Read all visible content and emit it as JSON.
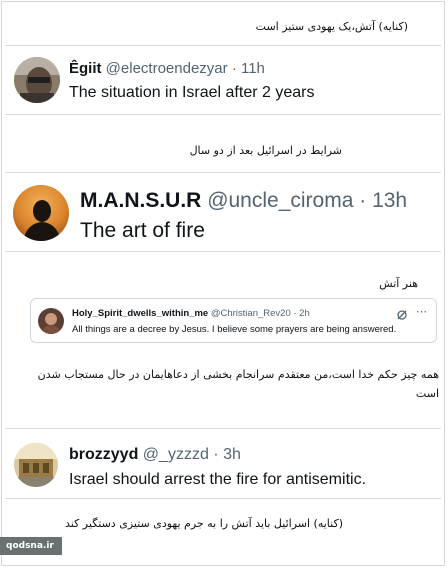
{
  "captions": {
    "c1": "(کنایه) آتش،یک یهودی ستیز است",
    "c2": "شرایط در اسرائیل بعد از دو سال",
    "c3": "هنر آتش",
    "c4_line1": "همه چیز حکم خدا است،من معتقدم سرانجام بخشی از دعاهایمان در حال مستجاب شدن",
    "c4_line2": "است",
    "c5": "(کنایه) اسرائیل باید آتش را به جرم یهودی ستیزی دستگیر کند"
  },
  "tweet1": {
    "name": "Êgiit",
    "handle": "@electroendezyar",
    "time": "· 11h",
    "text": "The situation in Israel after 2 years"
  },
  "tweet2": {
    "name": "M.A.N.S.U.R",
    "handle": "@uncle_ciroma",
    "time": "· 13h",
    "text": "The art of fire"
  },
  "quote": {
    "name": "Holy_Spirit_dwells_within_me",
    "handle": "@Christian_Rev20",
    "time": "· 2h",
    "text": "All things are a decree by Jesus. I believe some prayers are being answered.",
    "icon": "grok-icon"
  },
  "tweet3": {
    "name": "brozzyyd",
    "handle": "@_yzzzd",
    "time": "· 3h",
    "text": "Israel should arrest the fire for antisemitic."
  },
  "watermark": "qodsna.ir"
}
